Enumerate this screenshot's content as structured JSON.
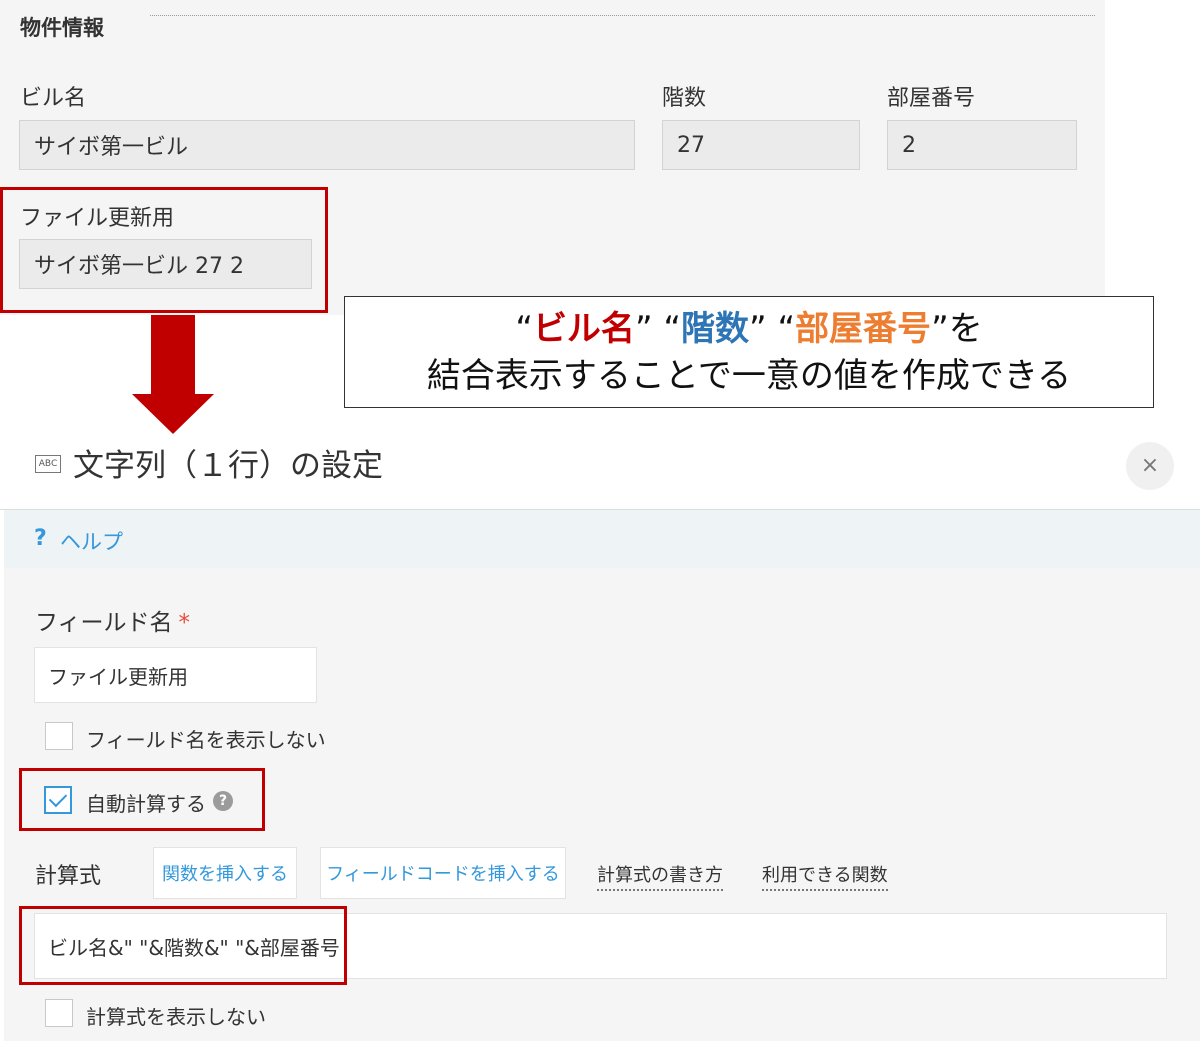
{
  "record": {
    "section_title": "物件情報",
    "fields": [
      {
        "label": "ビル名",
        "value": "サイボ第一ビル"
      },
      {
        "label": "階数",
        "value": "27"
      },
      {
        "label": "部屋番号",
        "value": "2"
      }
    ],
    "combined_field": {
      "label": "ファイル更新用",
      "value": "サイボ第一ビル 27 2"
    }
  },
  "callout": {
    "q_open1": "“",
    "term1": "ビル名",
    "q_close1": "”",
    "q_open2": "“",
    "term2": "階数",
    "q_close2": "”",
    "q_open3": "“",
    "term3": "部屋番号",
    "q_close3": "”",
    "suffix": "を",
    "line2": "結合表示することで一意の値を作成できる",
    "colors": {
      "term1": "#c00000",
      "term2": "#2e75b6",
      "term3": "#ed7d31"
    }
  },
  "dialog": {
    "icon_text": "ABC",
    "title": "文字列（１行）の設定",
    "close_glyph": "×",
    "help_glyph": "?",
    "help_label": "ヘルプ",
    "field_name_label": "フィールド名",
    "required_mark": "*",
    "field_name_value": "ファイル更新用",
    "hide_field_name_label": "フィールド名を表示しない",
    "hide_field_name_checked": false,
    "auto_calc_label": "自動計算する",
    "auto_calc_checked": true,
    "auto_calc_help_glyph": "?",
    "formula_label": "計算式",
    "insert_function_button": "関数を挿入する",
    "insert_field_code_button": "フィールドコードを挿入する",
    "formula_howto_link": "計算式の書き方",
    "available_functions_link": "利用できる関数",
    "formula_value": "ビル名&\" \"&階数&\" \"&部屋番号",
    "hide_formula_label": "計算式を表示しない",
    "hide_formula_checked": false
  },
  "colors": {
    "highlight": "#c00000",
    "link": "#3498db"
  }
}
